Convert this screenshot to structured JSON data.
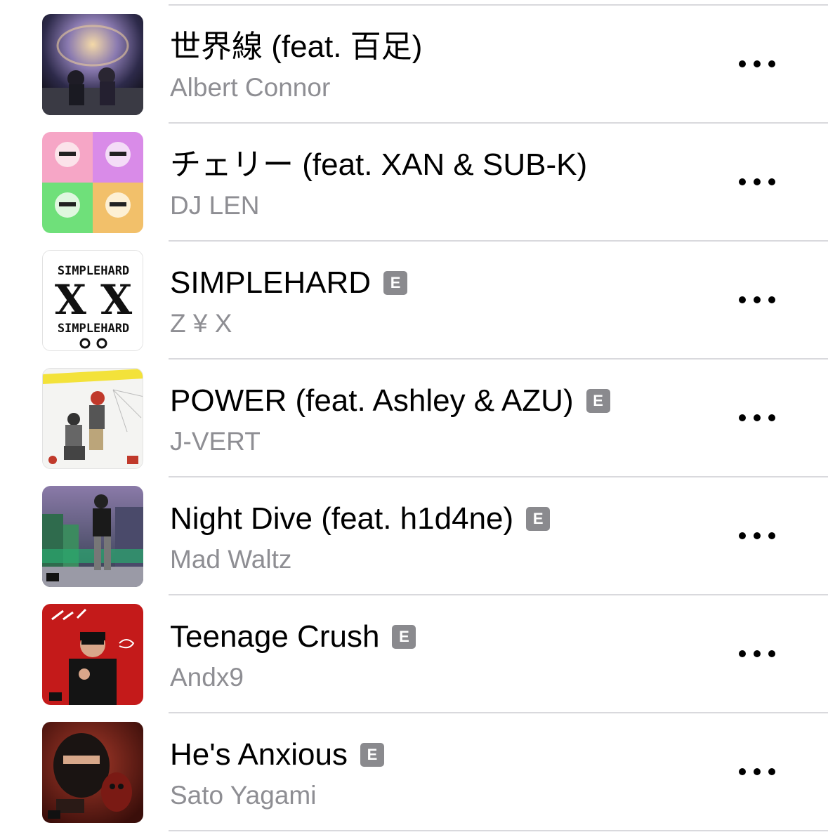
{
  "explicit_label": "E",
  "songs": [
    {
      "title": "世界線 (feat. 百足)",
      "artist": "Albert Connor",
      "explicit": false,
      "art_icon": "album-art-space"
    },
    {
      "title": "チェリー (feat. XAN & SUB-K)",
      "artist": "DJ LEN",
      "explicit": false,
      "art_icon": "album-art-four-panel"
    },
    {
      "title": "SIMPLEHARD",
      "artist": "Z ¥ X",
      "explicit": true,
      "art_icon": "album-art-simplehard",
      "art_text": "SIMPLEHARD",
      "art_big": "X X"
    },
    {
      "title": "POWER (feat. Ashley & AZU)",
      "artist": "J-VERT",
      "explicit": true,
      "art_icon": "album-art-caution"
    },
    {
      "title": "Night Dive (feat. h1d4ne)",
      "artist": "Mad Waltz",
      "explicit": true,
      "art_icon": "album-art-city"
    },
    {
      "title": "Teenage Crush",
      "artist": "Andx9",
      "explicit": true,
      "art_icon": "album-art-red"
    },
    {
      "title": "He's Anxious",
      "artist": "Sato Yagami",
      "explicit": true,
      "art_icon": "album-art-dark-red"
    }
  ]
}
